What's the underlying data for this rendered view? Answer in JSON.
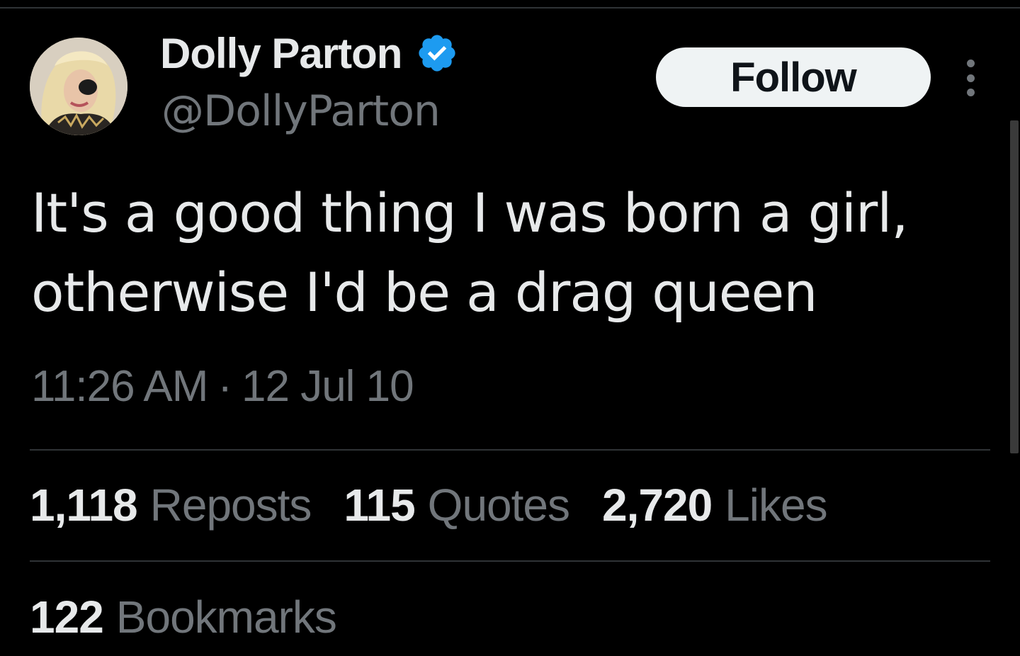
{
  "author": {
    "display_name": "Dolly Parton",
    "handle": "@DollyParton",
    "verified": true,
    "avatar_icon": "profile-photo"
  },
  "actions": {
    "follow_label": "Follow",
    "more_icon": "more-vertical-icon"
  },
  "tweet": {
    "text_lines": [
      "It's a good thing I was born a girl,",
      "otherwise I'd be a drag queen"
    ],
    "time": "11:26 AM",
    "separator": "·",
    "date": "12 Jul 10"
  },
  "stats": {
    "reposts": {
      "count": "1,118",
      "label": "Reposts"
    },
    "quotes": {
      "count": "115",
      "label": "Quotes"
    },
    "likes": {
      "count": "2,720",
      "label": "Likes"
    },
    "bookmarks": {
      "count": "122",
      "label": "Bookmarks"
    }
  },
  "colors": {
    "background": "#000000",
    "primary_text": "#e7e9ea",
    "secondary_text": "#71767b",
    "divider": "#2f3336",
    "verified_blue": "#1d9bf0",
    "follow_button_bg": "#eff3f4"
  }
}
